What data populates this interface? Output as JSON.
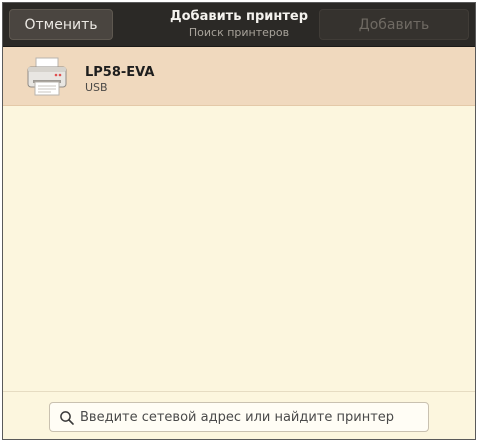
{
  "headerbar": {
    "cancel_label": "Отменить",
    "title": "Добавить принтер",
    "subtitle": "Поиск принтеров",
    "add_label": "Добавить"
  },
  "printers": [
    {
      "name": "LP58-EVA",
      "connection": "USB",
      "icon": "printer-icon",
      "selected": true
    }
  ],
  "search": {
    "placeholder": "Введите сетевой адрес или найдите принтер",
    "value": "",
    "icon": "search-icon"
  },
  "colors": {
    "headerbar": "#2b2926",
    "selected_row": "#f0d9be",
    "background": "#fcf6de"
  }
}
